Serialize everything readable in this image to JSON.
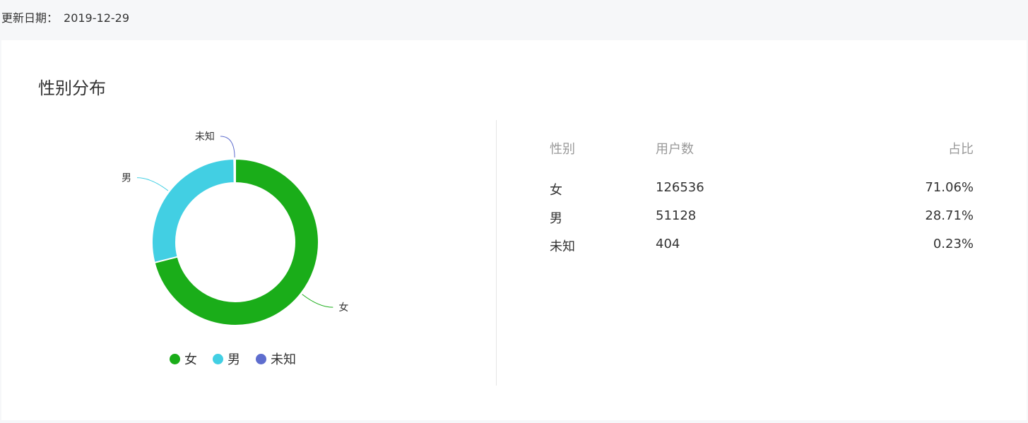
{
  "update": {
    "label": "更新日期：",
    "date": "2019-12-29"
  },
  "card": {
    "title": "性别分布"
  },
  "table": {
    "headers": [
      "性别",
      "用户数",
      "占比"
    ],
    "rows": [
      {
        "gender": "女",
        "count": "126536",
        "ratio": "71.06%"
      },
      {
        "gender": "男",
        "count": "51128",
        "ratio": "28.71%"
      },
      {
        "gender": "未知",
        "count": "404",
        "ratio": "0.23%"
      }
    ]
  },
  "chart_data": {
    "type": "pie",
    "labels": [
      "女",
      "男",
      "未知"
    ],
    "values": [
      126536,
      51128,
      404
    ],
    "colors": [
      "#1aad19",
      "#42cfe3",
      "#5e6dce"
    ],
    "legend": "bottom"
  }
}
